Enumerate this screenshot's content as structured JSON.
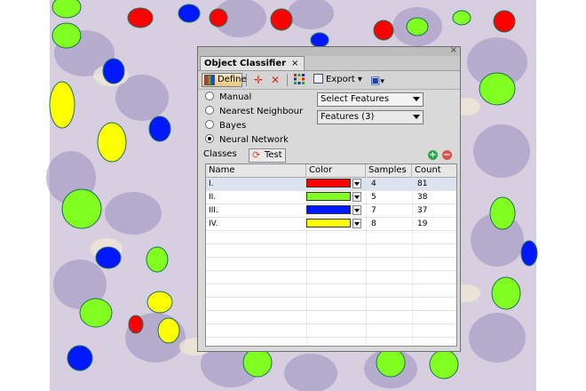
{
  "panel": {
    "tab_title": "Object Classifier",
    "tab_close": "×",
    "strip_close": "×"
  },
  "toolbar": {
    "define_label": "Define",
    "export_label": "Export"
  },
  "methods": [
    {
      "label": "Manual",
      "selected": false
    },
    {
      "label": "Nearest Neighbour",
      "selected": false
    },
    {
      "label": "Bayes",
      "selected": false
    },
    {
      "label": "Neural Network",
      "selected": true
    }
  ],
  "selects": {
    "select_features": "Select Features",
    "features": "Features (3)"
  },
  "classes": {
    "label": "Classes",
    "test_label": "Test"
  },
  "table": {
    "headers": [
      "Name",
      "Color",
      "Samples",
      "Count"
    ],
    "rows": [
      {
        "name": "I.",
        "color": "#ff0000",
        "samples": "4",
        "count": "81"
      },
      {
        "name": "II.",
        "color": "#80ff20",
        "samples": "5",
        "count": "38"
      },
      {
        "name": "III.",
        "color": "#0018ff",
        "samples": "7",
        "count": "37"
      },
      {
        "name": "IV.",
        "color": "#ffff00",
        "samples": "8",
        "count": "19"
      }
    ]
  },
  "colors": {
    "accent_plus": "#2fa44f",
    "accent_minus": "#d9534f"
  }
}
